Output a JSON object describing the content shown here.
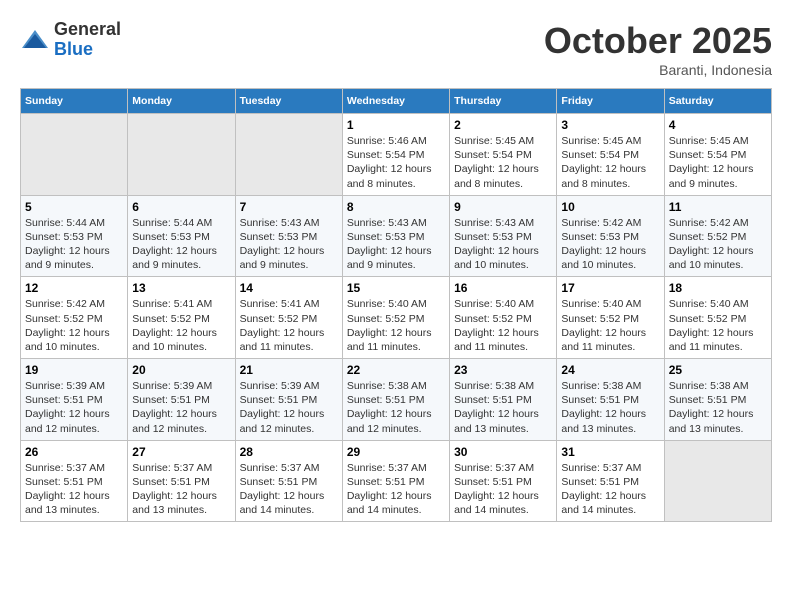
{
  "header": {
    "logo": {
      "line1": "General",
      "line2": "Blue"
    },
    "title": "October 2025",
    "location": "Baranti, Indonesia"
  },
  "days_of_week": [
    "Sunday",
    "Monday",
    "Tuesday",
    "Wednesday",
    "Thursday",
    "Friday",
    "Saturday"
  ],
  "weeks": [
    [
      {
        "day": "",
        "empty": true
      },
      {
        "day": "",
        "empty": true
      },
      {
        "day": "",
        "empty": true
      },
      {
        "day": "1",
        "sunrise": "5:46 AM",
        "sunset": "5:54 PM",
        "daylight": "12 hours and 8 minutes."
      },
      {
        "day": "2",
        "sunrise": "5:45 AM",
        "sunset": "5:54 PM",
        "daylight": "12 hours and 8 minutes."
      },
      {
        "day": "3",
        "sunrise": "5:45 AM",
        "sunset": "5:54 PM",
        "daylight": "12 hours and 8 minutes."
      },
      {
        "day": "4",
        "sunrise": "5:45 AM",
        "sunset": "5:54 PM",
        "daylight": "12 hours and 9 minutes."
      }
    ],
    [
      {
        "day": "5",
        "sunrise": "5:44 AM",
        "sunset": "5:53 PM",
        "daylight": "12 hours and 9 minutes."
      },
      {
        "day": "6",
        "sunrise": "5:44 AM",
        "sunset": "5:53 PM",
        "daylight": "12 hours and 9 minutes."
      },
      {
        "day": "7",
        "sunrise": "5:43 AM",
        "sunset": "5:53 PM",
        "daylight": "12 hours and 9 minutes."
      },
      {
        "day": "8",
        "sunrise": "5:43 AM",
        "sunset": "5:53 PM",
        "daylight": "12 hours and 9 minutes."
      },
      {
        "day": "9",
        "sunrise": "5:43 AM",
        "sunset": "5:53 PM",
        "daylight": "12 hours and 10 minutes."
      },
      {
        "day": "10",
        "sunrise": "5:42 AM",
        "sunset": "5:53 PM",
        "daylight": "12 hours and 10 minutes."
      },
      {
        "day": "11",
        "sunrise": "5:42 AM",
        "sunset": "5:52 PM",
        "daylight": "12 hours and 10 minutes."
      }
    ],
    [
      {
        "day": "12",
        "sunrise": "5:42 AM",
        "sunset": "5:52 PM",
        "daylight": "12 hours and 10 minutes."
      },
      {
        "day": "13",
        "sunrise": "5:41 AM",
        "sunset": "5:52 PM",
        "daylight": "12 hours and 10 minutes."
      },
      {
        "day": "14",
        "sunrise": "5:41 AM",
        "sunset": "5:52 PM",
        "daylight": "12 hours and 11 minutes."
      },
      {
        "day": "15",
        "sunrise": "5:40 AM",
        "sunset": "5:52 PM",
        "daylight": "12 hours and 11 minutes."
      },
      {
        "day": "16",
        "sunrise": "5:40 AM",
        "sunset": "5:52 PM",
        "daylight": "12 hours and 11 minutes."
      },
      {
        "day": "17",
        "sunrise": "5:40 AM",
        "sunset": "5:52 PM",
        "daylight": "12 hours and 11 minutes."
      },
      {
        "day": "18",
        "sunrise": "5:40 AM",
        "sunset": "5:52 PM",
        "daylight": "12 hours and 11 minutes."
      }
    ],
    [
      {
        "day": "19",
        "sunrise": "5:39 AM",
        "sunset": "5:51 PM",
        "daylight": "12 hours and 12 minutes."
      },
      {
        "day": "20",
        "sunrise": "5:39 AM",
        "sunset": "5:51 PM",
        "daylight": "12 hours and 12 minutes."
      },
      {
        "day": "21",
        "sunrise": "5:39 AM",
        "sunset": "5:51 PM",
        "daylight": "12 hours and 12 minutes."
      },
      {
        "day": "22",
        "sunrise": "5:38 AM",
        "sunset": "5:51 PM",
        "daylight": "12 hours and 12 minutes."
      },
      {
        "day": "23",
        "sunrise": "5:38 AM",
        "sunset": "5:51 PM",
        "daylight": "12 hours and 13 minutes."
      },
      {
        "day": "24",
        "sunrise": "5:38 AM",
        "sunset": "5:51 PM",
        "daylight": "12 hours and 13 minutes."
      },
      {
        "day": "25",
        "sunrise": "5:38 AM",
        "sunset": "5:51 PM",
        "daylight": "12 hours and 13 minutes."
      }
    ],
    [
      {
        "day": "26",
        "sunrise": "5:37 AM",
        "sunset": "5:51 PM",
        "daylight": "12 hours and 13 minutes."
      },
      {
        "day": "27",
        "sunrise": "5:37 AM",
        "sunset": "5:51 PM",
        "daylight": "12 hours and 13 minutes."
      },
      {
        "day": "28",
        "sunrise": "5:37 AM",
        "sunset": "5:51 PM",
        "daylight": "12 hours and 14 minutes."
      },
      {
        "day": "29",
        "sunrise": "5:37 AM",
        "sunset": "5:51 PM",
        "daylight": "12 hours and 14 minutes."
      },
      {
        "day": "30",
        "sunrise": "5:37 AM",
        "sunset": "5:51 PM",
        "daylight": "12 hours and 14 minutes."
      },
      {
        "day": "31",
        "sunrise": "5:37 AM",
        "sunset": "5:51 PM",
        "daylight": "12 hours and 14 minutes."
      },
      {
        "day": "",
        "empty": true
      }
    ]
  ],
  "labels": {
    "sunrise": "Sunrise:",
    "sunset": "Sunset:",
    "daylight": "Daylight:"
  }
}
